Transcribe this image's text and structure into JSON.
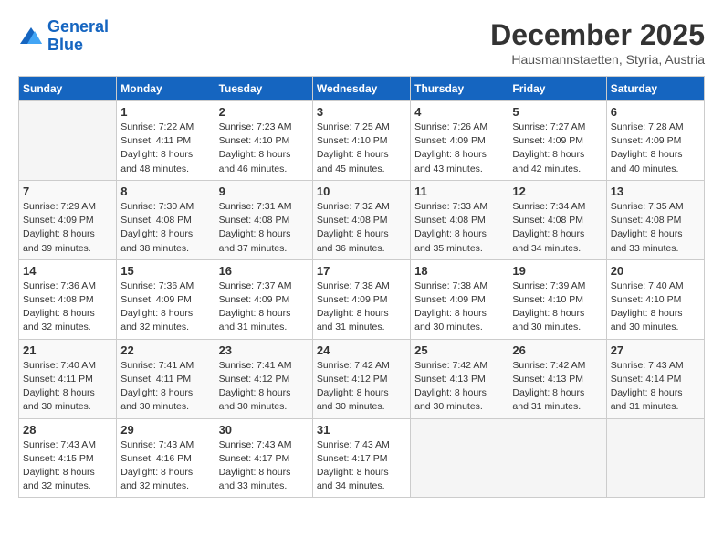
{
  "logo": {
    "line1": "General",
    "line2": "Blue"
  },
  "title": "December 2025",
  "subtitle": "Hausmannstaetten, Styria, Austria",
  "days_of_week": [
    "Sunday",
    "Monday",
    "Tuesday",
    "Wednesday",
    "Thursday",
    "Friday",
    "Saturday"
  ],
  "weeks": [
    [
      {
        "day": "",
        "info": ""
      },
      {
        "day": "1",
        "info": "Sunrise: 7:22 AM\nSunset: 4:11 PM\nDaylight: 8 hours\nand 48 minutes."
      },
      {
        "day": "2",
        "info": "Sunrise: 7:23 AM\nSunset: 4:10 PM\nDaylight: 8 hours\nand 46 minutes."
      },
      {
        "day": "3",
        "info": "Sunrise: 7:25 AM\nSunset: 4:10 PM\nDaylight: 8 hours\nand 45 minutes."
      },
      {
        "day": "4",
        "info": "Sunrise: 7:26 AM\nSunset: 4:09 PM\nDaylight: 8 hours\nand 43 minutes."
      },
      {
        "day": "5",
        "info": "Sunrise: 7:27 AM\nSunset: 4:09 PM\nDaylight: 8 hours\nand 42 minutes."
      },
      {
        "day": "6",
        "info": "Sunrise: 7:28 AM\nSunset: 4:09 PM\nDaylight: 8 hours\nand 40 minutes."
      }
    ],
    [
      {
        "day": "7",
        "info": "Sunrise: 7:29 AM\nSunset: 4:09 PM\nDaylight: 8 hours\nand 39 minutes."
      },
      {
        "day": "8",
        "info": "Sunrise: 7:30 AM\nSunset: 4:08 PM\nDaylight: 8 hours\nand 38 minutes."
      },
      {
        "day": "9",
        "info": "Sunrise: 7:31 AM\nSunset: 4:08 PM\nDaylight: 8 hours\nand 37 minutes."
      },
      {
        "day": "10",
        "info": "Sunrise: 7:32 AM\nSunset: 4:08 PM\nDaylight: 8 hours\nand 36 minutes."
      },
      {
        "day": "11",
        "info": "Sunrise: 7:33 AM\nSunset: 4:08 PM\nDaylight: 8 hours\nand 35 minutes."
      },
      {
        "day": "12",
        "info": "Sunrise: 7:34 AM\nSunset: 4:08 PM\nDaylight: 8 hours\nand 34 minutes."
      },
      {
        "day": "13",
        "info": "Sunrise: 7:35 AM\nSunset: 4:08 PM\nDaylight: 8 hours\nand 33 minutes."
      }
    ],
    [
      {
        "day": "14",
        "info": "Sunrise: 7:36 AM\nSunset: 4:08 PM\nDaylight: 8 hours\nand 32 minutes."
      },
      {
        "day": "15",
        "info": "Sunrise: 7:36 AM\nSunset: 4:09 PM\nDaylight: 8 hours\nand 32 minutes."
      },
      {
        "day": "16",
        "info": "Sunrise: 7:37 AM\nSunset: 4:09 PM\nDaylight: 8 hours\nand 31 minutes."
      },
      {
        "day": "17",
        "info": "Sunrise: 7:38 AM\nSunset: 4:09 PM\nDaylight: 8 hours\nand 31 minutes."
      },
      {
        "day": "18",
        "info": "Sunrise: 7:38 AM\nSunset: 4:09 PM\nDaylight: 8 hours\nand 30 minutes."
      },
      {
        "day": "19",
        "info": "Sunrise: 7:39 AM\nSunset: 4:10 PM\nDaylight: 8 hours\nand 30 minutes."
      },
      {
        "day": "20",
        "info": "Sunrise: 7:40 AM\nSunset: 4:10 PM\nDaylight: 8 hours\nand 30 minutes."
      }
    ],
    [
      {
        "day": "21",
        "info": "Sunrise: 7:40 AM\nSunset: 4:11 PM\nDaylight: 8 hours\nand 30 minutes."
      },
      {
        "day": "22",
        "info": "Sunrise: 7:41 AM\nSunset: 4:11 PM\nDaylight: 8 hours\nand 30 minutes."
      },
      {
        "day": "23",
        "info": "Sunrise: 7:41 AM\nSunset: 4:12 PM\nDaylight: 8 hours\nand 30 minutes."
      },
      {
        "day": "24",
        "info": "Sunrise: 7:42 AM\nSunset: 4:12 PM\nDaylight: 8 hours\nand 30 minutes."
      },
      {
        "day": "25",
        "info": "Sunrise: 7:42 AM\nSunset: 4:13 PM\nDaylight: 8 hours\nand 30 minutes."
      },
      {
        "day": "26",
        "info": "Sunrise: 7:42 AM\nSunset: 4:13 PM\nDaylight: 8 hours\nand 31 minutes."
      },
      {
        "day": "27",
        "info": "Sunrise: 7:43 AM\nSunset: 4:14 PM\nDaylight: 8 hours\nand 31 minutes."
      }
    ],
    [
      {
        "day": "28",
        "info": "Sunrise: 7:43 AM\nSunset: 4:15 PM\nDaylight: 8 hours\nand 32 minutes."
      },
      {
        "day": "29",
        "info": "Sunrise: 7:43 AM\nSunset: 4:16 PM\nDaylight: 8 hours\nand 32 minutes."
      },
      {
        "day": "30",
        "info": "Sunrise: 7:43 AM\nSunset: 4:17 PM\nDaylight: 8 hours\nand 33 minutes."
      },
      {
        "day": "31",
        "info": "Sunrise: 7:43 AM\nSunset: 4:17 PM\nDaylight: 8 hours\nand 34 minutes."
      },
      {
        "day": "",
        "info": ""
      },
      {
        "day": "",
        "info": ""
      },
      {
        "day": "",
        "info": ""
      }
    ]
  ]
}
